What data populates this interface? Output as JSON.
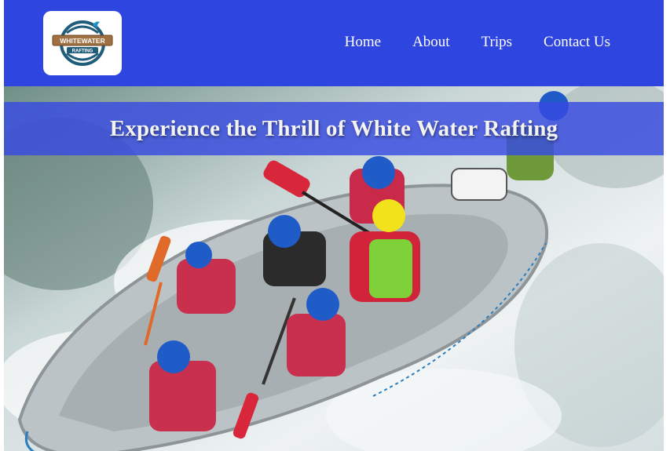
{
  "logo": {
    "line1": "WHITEWATER",
    "line2": "RAFTING"
  },
  "nav": {
    "home": "Home",
    "about": "About",
    "trips": "Trips",
    "contact": "Contact Us"
  },
  "hero": {
    "title": "Experience the Thrill of White Water Rafting"
  },
  "colors": {
    "header_bg": "#2f45e0",
    "banner_bg": "#374be1",
    "text": "#ffffff"
  },
  "hero_image": {
    "description_icon": "raft-photo"
  }
}
